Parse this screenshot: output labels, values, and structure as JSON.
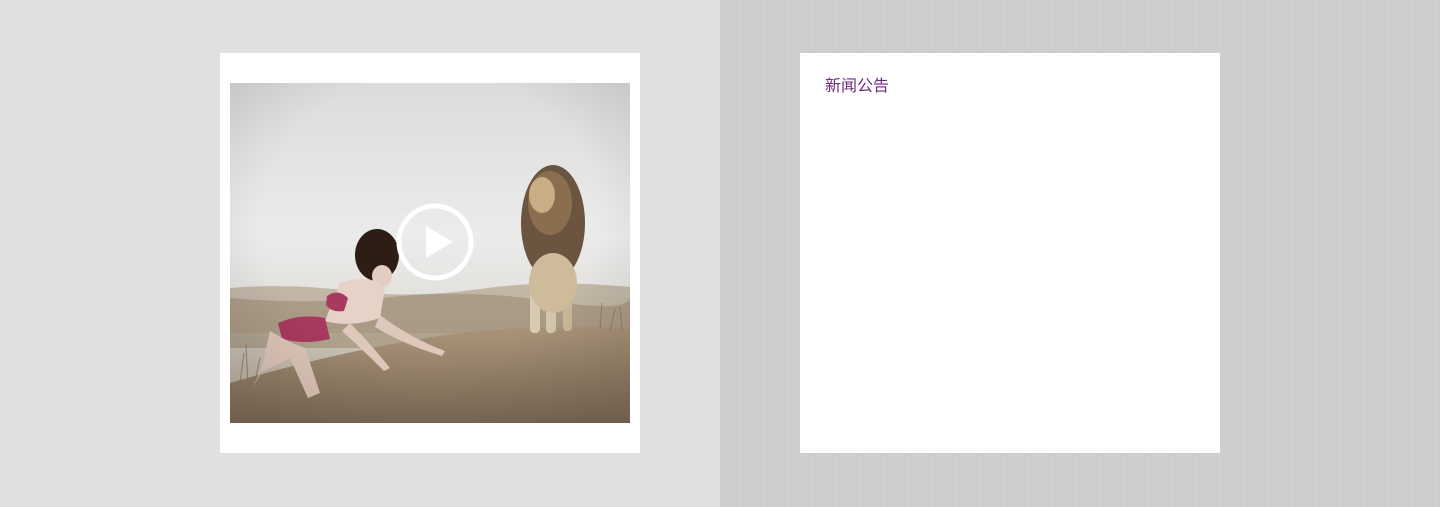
{
  "video": {
    "photo_label": "photo-of-woman-and-lion",
    "play_icon": "play-circle-icon"
  },
  "news": {
    "title": "新闻公告"
  },
  "colors": {
    "left_background": "#e0e0e0",
    "right_background": "#cdcdcd",
    "card_background": "#ffffff",
    "news_title": "#6f2a7e"
  }
}
